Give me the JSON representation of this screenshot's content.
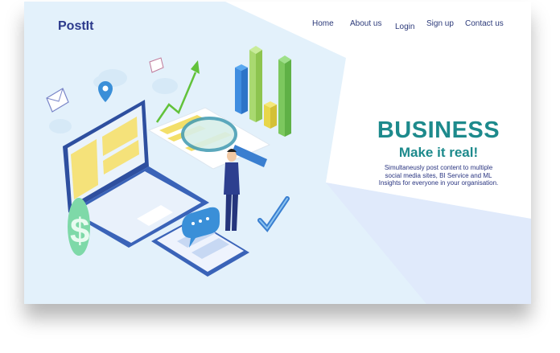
{
  "header": {
    "logo_text": "PostIt",
    "nav": [
      {
        "label": "Home"
      },
      {
        "label": "About us"
      },
      {
        "label": "Login"
      },
      {
        "label": "Sign up"
      },
      {
        "label": "Contact us"
      }
    ]
  },
  "hero": {
    "headline": "BUSINESS",
    "subheadline": "Make it real!",
    "description_lines": [
      "Simultaneusly post content to multiple",
      "social media sites, BI Service and ML",
      "Insights for everyone in your organisation."
    ]
  },
  "colors": {
    "brand": "#2c3a8c",
    "accent": "#1d8a8c",
    "background": "#e7f3fb"
  },
  "icons": [
    "laptop-icon",
    "magnifier-icon",
    "bar-chart-icon",
    "dollar-icon",
    "phone-icon",
    "chat-bubble-icon",
    "checkmark-icon",
    "envelope-icon",
    "location-pin-icon",
    "cloud-icon",
    "trend-arrow-icon"
  ]
}
